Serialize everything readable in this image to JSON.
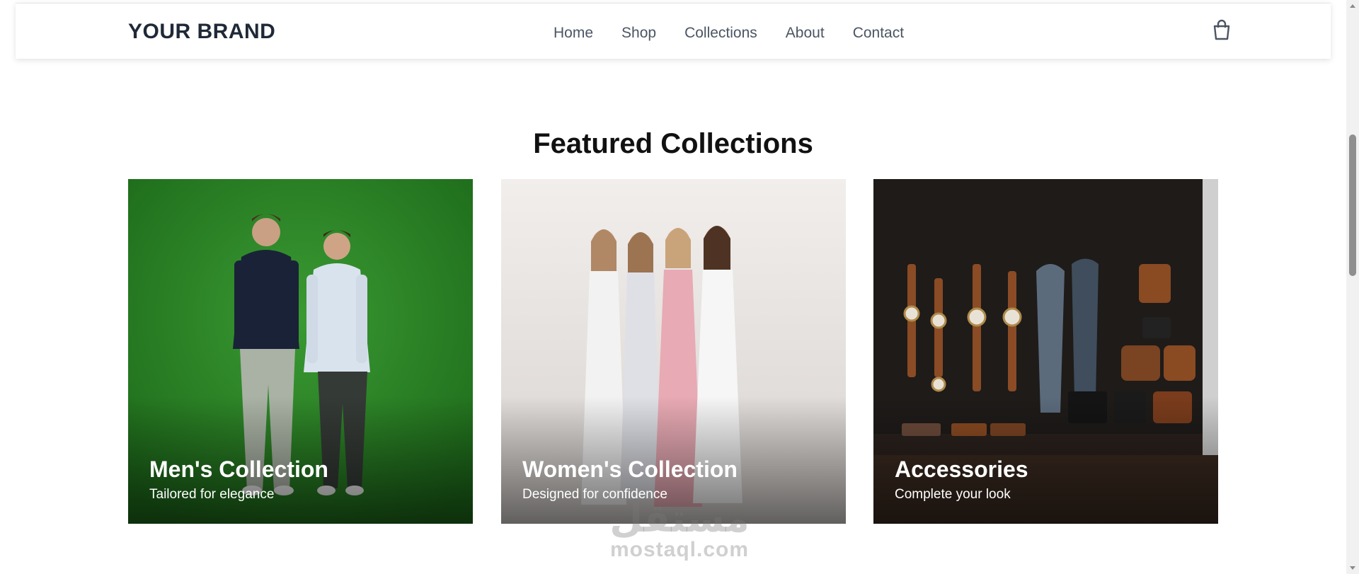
{
  "header": {
    "brand": "YOUR BRAND",
    "nav": [
      {
        "label": "Home"
      },
      {
        "label": "Shop"
      },
      {
        "label": "Collections"
      },
      {
        "label": "About"
      },
      {
        "label": "Contact"
      }
    ],
    "cart_icon": "shopping-bag-icon"
  },
  "main": {
    "section_title": "Featured Collections",
    "cards": [
      {
        "title": "Men's Collection",
        "subtitle": "Tailored for elegance"
      },
      {
        "title": "Women's Collection",
        "subtitle": "Designed for confidence"
      },
      {
        "title": "Accessories",
        "subtitle": "Complete your look"
      }
    ]
  },
  "watermark": {
    "arabic": "مستقل",
    "latin": "mostaql.com"
  },
  "colors": {
    "brand_text": "#1f2937",
    "nav_text": "#4b5563",
    "men_bg": "#2f8a2b",
    "women_bg": "#e9e5e3",
    "accessories_bg": "#1e1b19"
  }
}
